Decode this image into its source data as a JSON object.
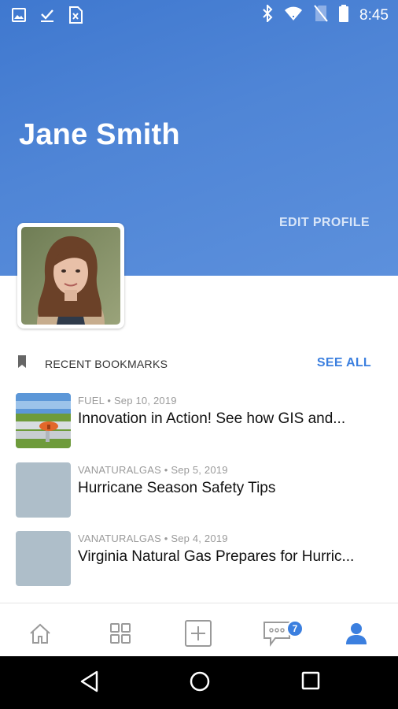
{
  "status_bar": {
    "time": "8:45",
    "left_icons": [
      "image-icon",
      "checkmark-download-icon",
      "file-x-icon"
    ],
    "right_icons": [
      "bluetooth-icon",
      "wifi-icon",
      "no-sim-icon",
      "battery-icon"
    ]
  },
  "profile": {
    "name": "Jane Smith",
    "edit_label": "EDIT PROFILE"
  },
  "bookmarks_section": {
    "title": "RECENT BOOKMARKS",
    "see_all_label": "SEE ALL",
    "items": [
      {
        "source": "FUEL",
        "date": "Sep 10, 2019",
        "title": "Innovation in Action! See how GIS and...",
        "thumb": "photo"
      },
      {
        "source": "VANATURALGAS",
        "date": "Sep 5, 2019",
        "title": "Hurricane Season Safety Tips",
        "thumb": "placeholder"
      },
      {
        "source": "VANATURALGAS",
        "date": "Sep 4, 2019",
        "title": "Virginia Natural Gas Prepares for Hurric...",
        "thumb": "placeholder"
      }
    ]
  },
  "tab_bar": {
    "tabs": [
      "home-icon",
      "grid-icon",
      "add-icon",
      "messages-icon",
      "profile-icon"
    ],
    "active": "profile-icon",
    "messages_badge": "7"
  },
  "colors": {
    "header_start": "#3f78cf",
    "header_end": "#5c90dc",
    "accent": "#3b7fdf",
    "thumb_placeholder": "#aebec9"
  }
}
